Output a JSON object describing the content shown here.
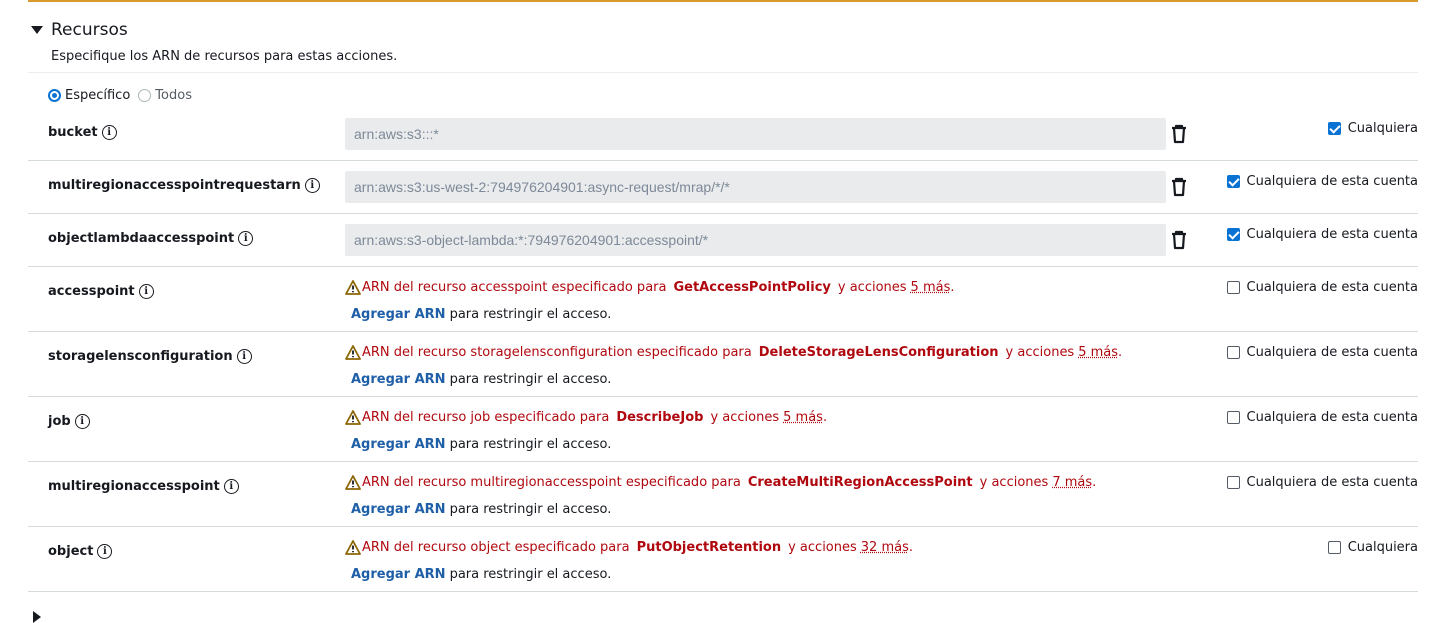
{
  "section": {
    "title": "Recursos",
    "description": "Especifique los ARN de recursos para estas acciones."
  },
  "scope": {
    "options": [
      {
        "label": "Específico",
        "selected": true
      },
      {
        "label": "Todos",
        "selected": false
      }
    ]
  },
  "resources": [
    {
      "name": "bucket",
      "arn": "arn:aws:s3:::*",
      "any_label": "Cualquiera",
      "any_checked": true
    },
    {
      "name": "multiregionaccesspointrequestarn",
      "arn": "arn:aws:s3:us-west-2:794976204901:async-request/mrap/*/*",
      "any_label": "Cualquiera de esta cuenta",
      "any_checked": true
    },
    {
      "name": "objectlambdaaccesspoint",
      "arn": "arn:aws:s3-object-lambda:*:794976204901:accesspoint/*",
      "any_label": "Cualquiera de esta cuenta",
      "any_checked": true
    },
    {
      "name": "accesspoint",
      "warning_prefix": "ARN del recurso accesspoint especificado para",
      "action": "GetAccessPointPolicy",
      "warning_suffix": "y acciones",
      "more": "5 más",
      "period": ".",
      "add_link": "Agregar ARN",
      "add_rest": "para restringir el acceso.",
      "any_label": "Cualquiera de esta cuenta",
      "any_checked": false
    },
    {
      "name": "storagelensconfiguration",
      "warning_prefix": "ARN del recurso storagelensconfiguration especificado para",
      "action": "DeleteStorageLensConfiguration",
      "warning_suffix": "y acciones",
      "more": "5 más",
      "period": ".",
      "add_link": "Agregar ARN",
      "add_rest": "para restringir el acceso.",
      "any_label": "Cualquiera de esta cuenta",
      "any_checked": false
    },
    {
      "name": "job",
      "warning_prefix": "ARN del recurso job especificado para",
      "action": "DescribeJob",
      "warning_suffix": "y acciones",
      "more": "5 más",
      "period": ".",
      "add_link": "Agregar ARN",
      "add_rest": "para restringir el acceso.",
      "any_label": "Cualquiera de esta cuenta",
      "any_checked": false
    },
    {
      "name": "multiregionaccesspoint",
      "warning_prefix": "ARN del recurso multiregionaccesspoint especificado para",
      "action": "CreateMultiRegionAccessPoint",
      "warning_suffix": "y acciones",
      "more": "7 más",
      "period": ".",
      "add_link": "Agregar ARN",
      "add_rest": "para restringir el acceso.",
      "any_label": "Cualquiera de esta cuenta",
      "any_checked": false
    },
    {
      "name": "object",
      "warning_prefix": "ARN del recurso object especificado para",
      "action": "PutObjectRetention",
      "warning_suffix": "y acciones",
      "more": "32 más",
      "period": ".",
      "add_link": "Agregar ARN",
      "add_rest": "para restringir el acceso.",
      "any_label": "Cualquiera",
      "any_checked": false
    }
  ],
  "colors": {
    "accent": "#0972d3",
    "warning_text": "#b0080f",
    "link": "#1f5fa8",
    "top_border": "#d89a2c"
  }
}
